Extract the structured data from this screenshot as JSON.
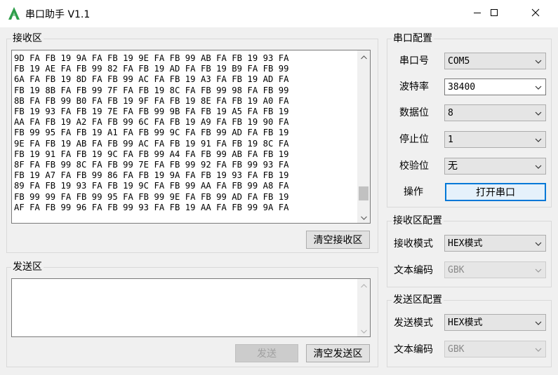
{
  "window": {
    "title": "串口助手 V1.1",
    "icon": "green-logo-icon",
    "controls": [
      "minimize-icon",
      "maximize-icon",
      "close-icon"
    ]
  },
  "receive_area": {
    "title": "接收区",
    "lines": [
      "9D FA FB 19 9A FA FB 19 9E FA FB 99 AB FA FB 19 93 FA",
      "FB 19 AE FA FB 99 82 FA FB 19 AD FA FB 19 B9 FA FB 99",
      "6A FA FB 19 8D FA FB 99 AC FA FB 19 A3 FA FB 19 AD FA",
      "FB 19 8B FA FB 99 7F FA FB 19 8C FA FB 99 98 FA FB 99",
      "8B FA FB 99 B0 FA FB 19 9F FA FB 19 8E FA FB 19 A0 FA",
      "FB 19 93 FA FB 19 7E FA FB 99 9B FA FB 19 A5 FA FB 19",
      "AA FA FB 19 A2 FA FB 99 6C FA FB 19 A9 FA FB 19 90 FA",
      "FB 99 95 FA FB 19 A1 FA FB 99 9C FA FB 99 AD FA FB 19",
      "9E FA FB 19 AB FA FB 99 AC FA FB 19 91 FA FB 19 8C FA",
      "FB 19 91 FA FB 19 9C FA FB 99 A4 FA FB 99 AB FA FB 19",
      "8F FA FB 99 8C FA FB 99 7E FA FB 99 92 FA FB 99 93 FA",
      "FB 19 A7 FA FB 99 86 FA FB 19 9A FA FB 19 93 FA FB 19",
      "89 FA FB 19 93 FA FB 19 9C FA FB 99 AA FA FB 99 A8 FA",
      "FB 99 99 FA FB 99 95 FA FB 99 9E FA FB 99 AD FA FB 19",
      "AF FA FB 99 96 FA FB 99 93 FA FB 19 AA FA FB 99 9A FA"
    ],
    "scroll_position": 0.92,
    "clear_button": "清空接收区"
  },
  "send_area": {
    "title": "发送区",
    "value": "",
    "send_button": "发送",
    "clear_button": "清空发送区"
  },
  "serial_config": {
    "title": "串口配置",
    "port_label": "串口号",
    "port_value": "COM5",
    "baud_label": "波特率",
    "baud_value": "38400",
    "databits_label": "数据位",
    "databits_value": "8",
    "stopbits_label": "停止位",
    "stopbits_value": "1",
    "parity_label": "校验位",
    "parity_value": "无",
    "action_label": "操作",
    "open_button": "打开串口"
  },
  "receive_config": {
    "title": "接收区配置",
    "mode_label": "接收模式",
    "mode_value": "HEX模式",
    "encoding_label": "文本编码",
    "encoding_value": "GBK"
  },
  "send_config": {
    "title": "发送区配置",
    "mode_label": "发送模式",
    "mode_value": "HEX模式",
    "encoding_label": "文本编码",
    "encoding_value": "GBK"
  }
}
